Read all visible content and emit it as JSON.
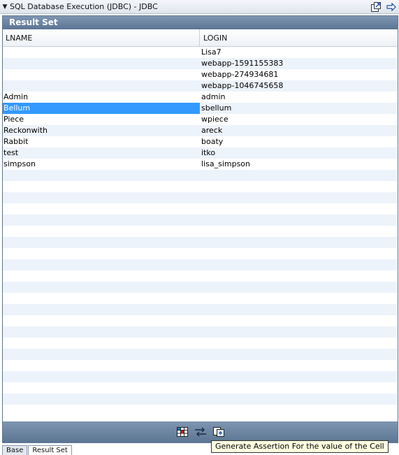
{
  "window": {
    "title": "SQL Database Execution (JDBC) - JDBC"
  },
  "panel": {
    "title": "Result Set"
  },
  "table": {
    "columns": [
      "LNAME",
      "LOGIN"
    ],
    "rows": [
      [
        "",
        "Lisa7"
      ],
      [
        "",
        "webapp-1591155383"
      ],
      [
        "",
        "webapp-274934681"
      ],
      [
        "",
        "webapp-1046745658"
      ],
      [
        "Admin",
        "admin"
      ],
      [
        "Bellum",
        "sbellum"
      ],
      [
        "Piece",
        "wpiece"
      ],
      [
        "Reckonwith",
        "areck"
      ],
      [
        "Rabbit",
        "boaty"
      ],
      [
        "test",
        "itko"
      ],
      [
        "simpson",
        "lisa_simpson"
      ]
    ],
    "empty_rows": 22,
    "selected_row": 5,
    "selected_col": 0,
    "selection_color": "#3399ff"
  },
  "footer": {
    "buttons": [
      {
        "name": "grid-icon"
      },
      {
        "name": "swap-arrows-icon"
      },
      {
        "name": "generate-assertion-icon"
      }
    ]
  },
  "tooltip": {
    "text": "Generate Assertion For the value of the Cell"
  },
  "tabs": [
    {
      "label": "Base"
    },
    {
      "label": "Result Set"
    }
  ]
}
